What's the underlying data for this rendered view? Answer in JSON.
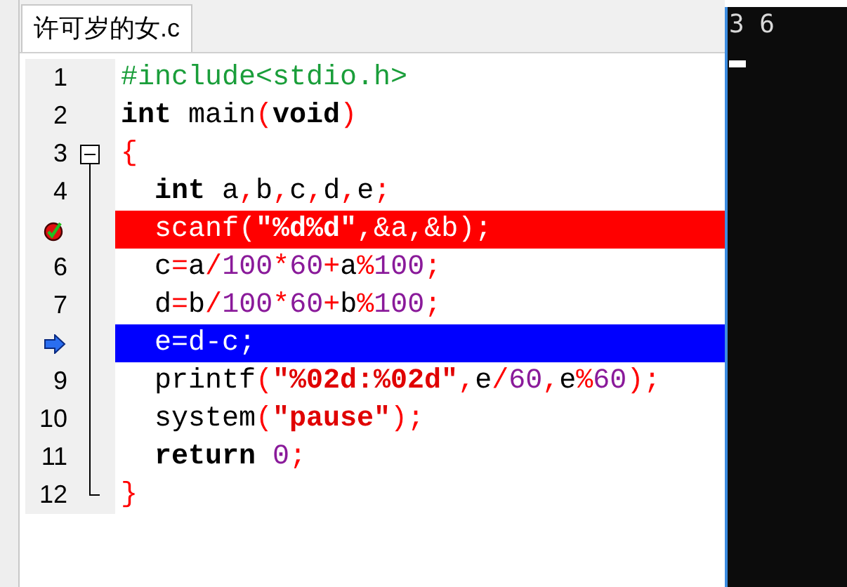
{
  "tab": {
    "label": "许可岁的女.c",
    "selected": true
  },
  "lines": [
    {
      "number": "1",
      "fold_start": false,
      "in_fold": false,
      "fold_end": false,
      "breakpoint": false,
      "current": false,
      "tokens": [
        {
          "text": "#include<stdio.h>",
          "kind": "preproc"
        }
      ]
    },
    {
      "number": "2",
      "fold_start": false,
      "in_fold": false,
      "fold_end": false,
      "breakpoint": false,
      "current": false,
      "tokens": [
        {
          "text": "int",
          "kind": "keyword"
        },
        {
          "text": " main",
          "kind": "ident"
        },
        {
          "text": "(",
          "kind": "punct"
        },
        {
          "text": "void",
          "kind": "keyword"
        },
        {
          "text": ")",
          "kind": "punct"
        }
      ]
    },
    {
      "number": "3",
      "fold_start": true,
      "in_fold": false,
      "fold_end": false,
      "breakpoint": false,
      "current": false,
      "tokens": [
        {
          "text": "{",
          "kind": "punct"
        }
      ]
    },
    {
      "number": "4",
      "fold_start": false,
      "in_fold": true,
      "fold_end": false,
      "breakpoint": false,
      "current": false,
      "tokens": [
        {
          "text": "  int",
          "kind": "keyword"
        },
        {
          "text": " a",
          "kind": "ident"
        },
        {
          "text": ",",
          "kind": "punct"
        },
        {
          "text": "b",
          "kind": "ident"
        },
        {
          "text": ",",
          "kind": "punct"
        },
        {
          "text": "c",
          "kind": "ident"
        },
        {
          "text": ",",
          "kind": "punct"
        },
        {
          "text": "d",
          "kind": "ident"
        },
        {
          "text": ",",
          "kind": "punct"
        },
        {
          "text": "e",
          "kind": "ident"
        },
        {
          "text": ";",
          "kind": "punct"
        }
      ]
    },
    {
      "fold_start": false,
      "in_fold": true,
      "fold_end": false,
      "breakpoint": true,
      "current": false,
      "tokens": [
        {
          "text": "  scanf",
          "kind": "ident"
        },
        {
          "text": "(",
          "kind": "punct"
        },
        {
          "text": "\"%d%d\"",
          "kind": "string"
        },
        {
          "text": ",&",
          "kind": "punct"
        },
        {
          "text": "a",
          "kind": "ident"
        },
        {
          "text": ",&",
          "kind": "punct"
        },
        {
          "text": "b",
          "kind": "ident"
        },
        {
          "text": ");",
          "kind": "punct"
        }
      ]
    },
    {
      "number": "6",
      "fold_start": false,
      "in_fold": true,
      "fold_end": false,
      "breakpoint": false,
      "current": false,
      "tokens": [
        {
          "text": "  c",
          "kind": "ident"
        },
        {
          "text": "=",
          "kind": "punct"
        },
        {
          "text": "a",
          "kind": "ident"
        },
        {
          "text": "/",
          "kind": "punct"
        },
        {
          "text": "100",
          "kind": "number"
        },
        {
          "text": "*",
          "kind": "punct"
        },
        {
          "text": "60",
          "kind": "number"
        },
        {
          "text": "+",
          "kind": "punct"
        },
        {
          "text": "a",
          "kind": "ident"
        },
        {
          "text": "%",
          "kind": "punct"
        },
        {
          "text": "100",
          "kind": "number"
        },
        {
          "text": ";",
          "kind": "punct"
        }
      ]
    },
    {
      "number": "7",
      "fold_start": false,
      "in_fold": true,
      "fold_end": false,
      "breakpoint": false,
      "current": false,
      "tokens": [
        {
          "text": "  d",
          "kind": "ident"
        },
        {
          "text": "=",
          "kind": "punct"
        },
        {
          "text": "b",
          "kind": "ident"
        },
        {
          "text": "/",
          "kind": "punct"
        },
        {
          "text": "100",
          "kind": "number"
        },
        {
          "text": "*",
          "kind": "punct"
        },
        {
          "text": "60",
          "kind": "number"
        },
        {
          "text": "+",
          "kind": "punct"
        },
        {
          "text": "b",
          "kind": "ident"
        },
        {
          "text": "%",
          "kind": "punct"
        },
        {
          "text": "100",
          "kind": "number"
        },
        {
          "text": ";",
          "kind": "punct"
        }
      ]
    },
    {
      "fold_start": false,
      "in_fold": true,
      "fold_end": false,
      "breakpoint": false,
      "current": true,
      "tokens": [
        {
          "text": "  e=d-c;",
          "kind": "ident"
        }
      ]
    },
    {
      "number": "9",
      "fold_start": false,
      "in_fold": true,
      "fold_end": false,
      "breakpoint": false,
      "current": false,
      "tokens": [
        {
          "text": "  printf",
          "kind": "ident"
        },
        {
          "text": "(",
          "kind": "punct"
        },
        {
          "text": "\"%02d:%02d\"",
          "kind": "string"
        },
        {
          "text": ",",
          "kind": "punct"
        },
        {
          "text": "e",
          "kind": "ident"
        },
        {
          "text": "/",
          "kind": "punct"
        },
        {
          "text": "60",
          "kind": "number"
        },
        {
          "text": ",",
          "kind": "punct"
        },
        {
          "text": "e",
          "kind": "ident"
        },
        {
          "text": "%",
          "kind": "punct"
        },
        {
          "text": "60",
          "kind": "number"
        },
        {
          "text": ");",
          "kind": "punct"
        }
      ]
    },
    {
      "number": "10",
      "fold_start": false,
      "in_fold": true,
      "fold_end": false,
      "breakpoint": false,
      "current": false,
      "tokens": [
        {
          "text": "  system",
          "kind": "ident"
        },
        {
          "text": "(",
          "kind": "punct"
        },
        {
          "text": "\"pause\"",
          "kind": "string"
        },
        {
          "text": ");",
          "kind": "punct"
        }
      ]
    },
    {
      "number": "11",
      "fold_start": false,
      "in_fold": true,
      "fold_end": false,
      "breakpoint": false,
      "current": false,
      "tokens": [
        {
          "text": "  return",
          "kind": "keyword"
        },
        {
          "text": " 0",
          "kind": "number"
        },
        {
          "text": ";",
          "kind": "punct"
        }
      ]
    },
    {
      "number": "12",
      "fold_start": false,
      "in_fold": false,
      "fold_end": true,
      "breakpoint": false,
      "current": false,
      "tokens": [
        {
          "text": "}",
          "kind": "punct"
        }
      ]
    }
  ],
  "console": {
    "output": "3 6"
  }
}
